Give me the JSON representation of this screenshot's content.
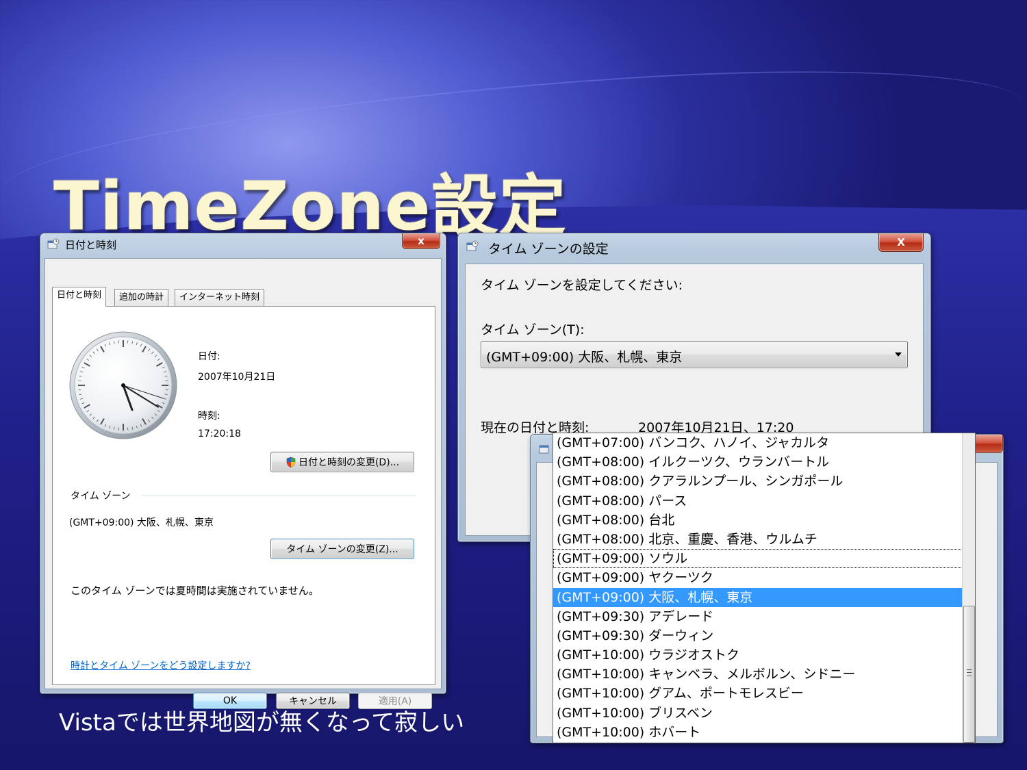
{
  "slide": {
    "title": "TimeZone設定",
    "caption": "Vistaでは世界地図が無くなって寂しい"
  },
  "colors": {
    "accent_selection": "#3399ff",
    "link": "#0066cc",
    "title_text": "#fbf6cf",
    "close_button": "#c9442c"
  },
  "date_time_dialog": {
    "title": "日付と時刻",
    "close_label": "x",
    "tabs": [
      "日付と時刻",
      "追加の時計",
      "インターネット時刻"
    ],
    "date_label": "日付:",
    "date_value": "2007年10月21日",
    "time_label": "時刻:",
    "time_value": "17:20:18",
    "change_datetime_button": "日付と時刻の変更(D)...",
    "timezone_group_label": "タイム ゾーン",
    "timezone_value": "(GMT+09:00) 大阪、札幌、東京",
    "change_timezone_button": "タイム ゾーンの変更(Z)...",
    "dst_note": "このタイム ゾーンでは夏時間は実施されていません。",
    "help_link": "時計とタイム ゾーンをどう設定しますか?",
    "ok_button": "OK",
    "cancel_button": "キャンセル",
    "apply_button": "適用(A)",
    "clock": {
      "hour": 17,
      "minute": 20,
      "second": 18
    }
  },
  "timezone_dialog": {
    "title": "タイム ゾーンの設定",
    "close_label": "X",
    "instruction": "タイム ゾーンを設定してください:",
    "timezone_label": "タイム ゾーン(T):",
    "selected": "(GMT+09:00) 大阪、札幌、東京",
    "current_label": "現在の日付と時刻:",
    "current_value": "2007年10月21日、17:20"
  },
  "timezone_list": {
    "items": [
      "(GMT+07:00) バンコク、ハノイ、ジャカルタ",
      "(GMT+08:00) イルクーツク、ウランバートル",
      "(GMT+08:00) クアラルンプール、シンガポール",
      "(GMT+08:00) パース",
      "(GMT+08:00) 台北",
      "(GMT+08:00) 北京、重慶、香港、ウルムチ",
      "(GMT+09:00) ソウル",
      "(GMT+09:00) ヤクーツク",
      "(GMT+09:00) 大阪、札幌、東京",
      "(GMT+09:30) アデレード",
      "(GMT+09:30) ダーウィン",
      "(GMT+10:00) ウラジオストク",
      "(GMT+10:00) キャンベラ、メルボルン、シドニー",
      "(GMT+10:00) グアム、ポートモレスビー",
      "(GMT+10:00) ブリスベン",
      "(GMT+10:00) ホバート"
    ],
    "focused_index": 6,
    "selected_index": 8
  }
}
